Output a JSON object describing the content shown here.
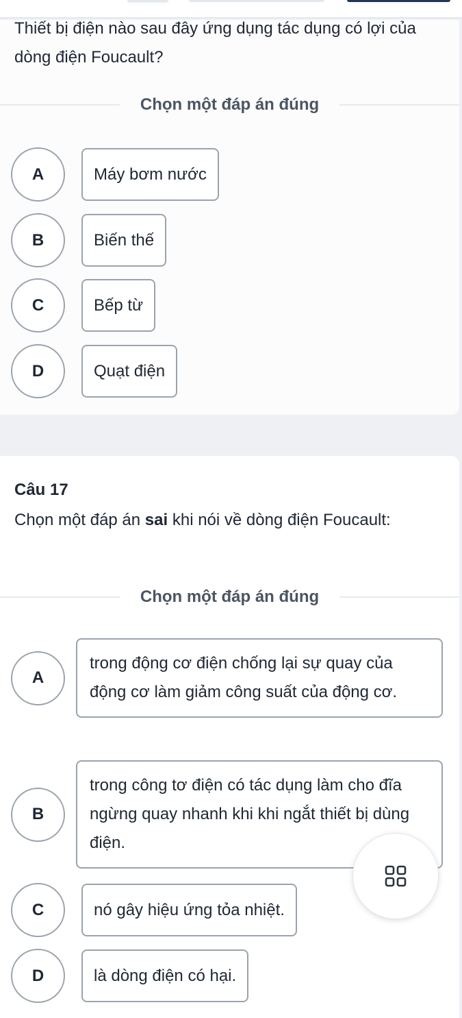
{
  "top_tabs": [
    {
      "name": "tab-indicator-1",
      "active": false
    },
    {
      "name": "tab-indicator-2",
      "active": false
    },
    {
      "name": "tab-indicator-3",
      "active": true
    }
  ],
  "questions": [
    {
      "number": "",
      "text": "Thiết bị điện nào sau đây ứng dụng tác dụng có lợi của dòng điện Foucault?",
      "instruction": "Chọn một đáp án đúng",
      "options": [
        {
          "letter": "A",
          "text": "Máy bơm nước"
        },
        {
          "letter": "B",
          "text": "Biến thế"
        },
        {
          "letter": "C",
          "text": "Bếp từ"
        },
        {
          "letter": "D",
          "text": "Quạt điện"
        }
      ]
    },
    {
      "number": "Câu 17",
      "text_before": "Chọn một đáp án ",
      "text_bold": "sai",
      "text_after": " khi nói về dòng điện Foucault:",
      "instruction": "Chọn một đáp án đúng",
      "options": [
        {
          "letter": "A",
          "text": "trong động cơ điện chống lại sự quay của động cơ làm giảm công suất của động cơ."
        },
        {
          "letter": "B",
          "text": "trong công tơ điện có tác dụng làm cho đĩa ngừng quay nhanh khi khi ngắt thiết bị dùng điện."
        },
        {
          "letter": "C",
          "text": "nó gây hiệu ứng tỏa nhiệt."
        },
        {
          "letter": "D",
          "text": "là dòng điện có hại."
        }
      ]
    }
  ],
  "fab": {
    "icon": "grid-icon"
  },
  "colors": {
    "page_bg": "#eef0f4",
    "card_bg": "#ffffff",
    "text": "#1f2733",
    "muted_text": "#4b5563",
    "border": "#9aa3ad",
    "active_tab": "#22355a"
  }
}
